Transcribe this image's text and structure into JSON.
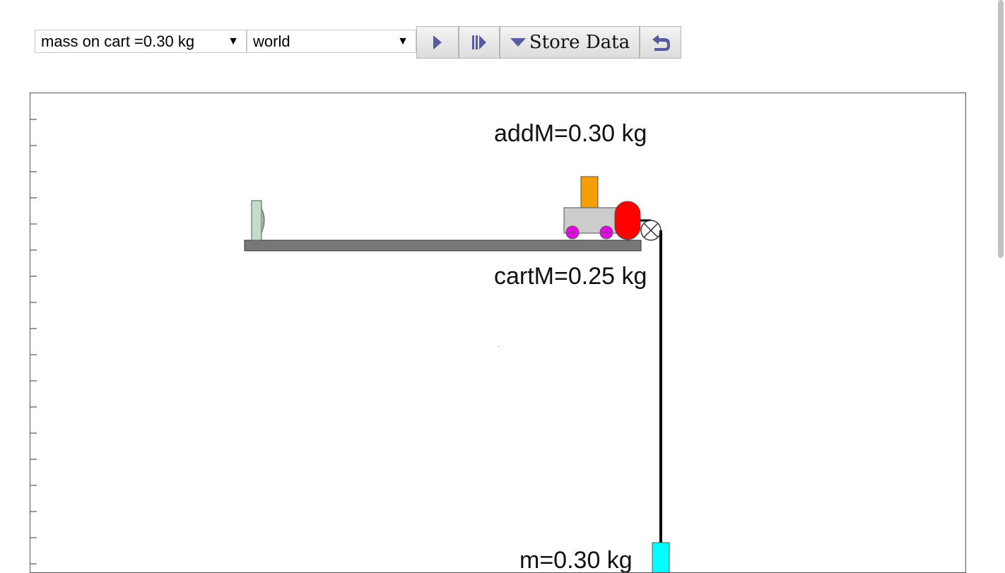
{
  "toolbar": {
    "mass_select": {
      "value": "mass on cart =0.30 kg"
    },
    "view_select": {
      "value": "world"
    },
    "play_icon": "play-icon",
    "step_icon": "step-forward-icon",
    "store_label": "Store Data",
    "undo_icon": "undo-icon"
  },
  "simulation": {
    "add_mass_label": "addM=0.30 kg",
    "cart_mass_label": "cartM=0.25 kg",
    "hanging_mass_label": "m=0.30 kg"
  },
  "colors": {
    "track": "#777777",
    "cart_body": "#cccccc",
    "added_mass": "#f5a000",
    "wheels": "#ee00ee",
    "bumper": "#ff0000",
    "hanging_mass": "#00ffff",
    "stopper": "#c4dccc",
    "button_icon": "#5a5aa0"
  }
}
